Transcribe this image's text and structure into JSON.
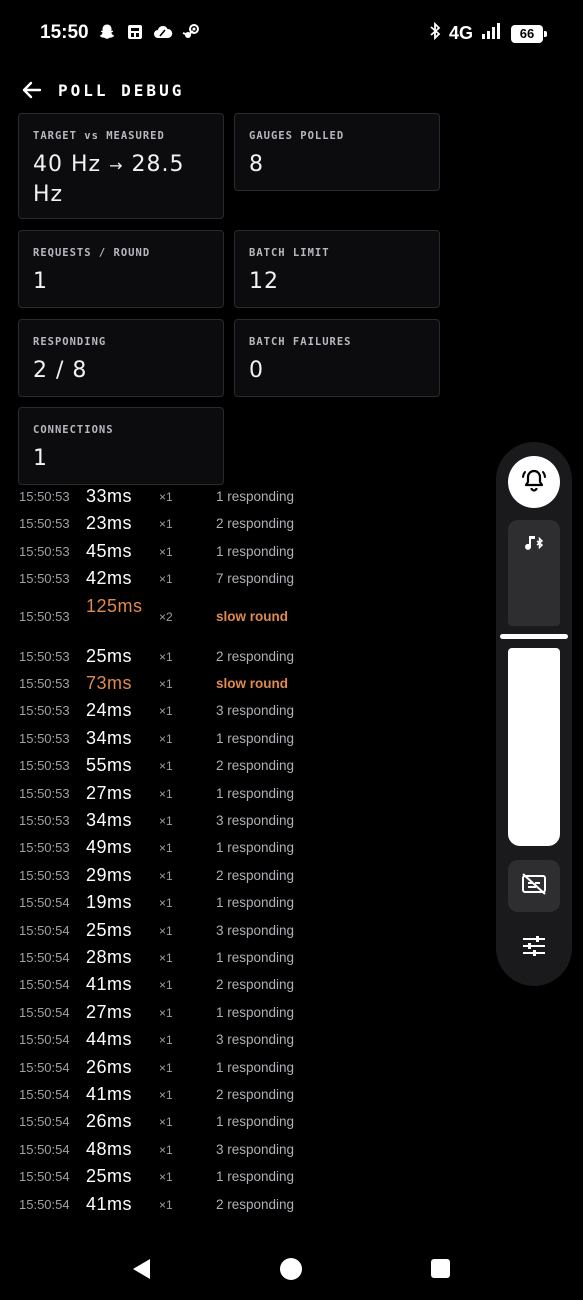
{
  "status": {
    "time": "15:50",
    "network": "4G",
    "battery": "66"
  },
  "header": {
    "title": "POLL DEBUG"
  },
  "cards": {
    "target": {
      "label": "TARGET vs MEASURED",
      "value_a": "40 Hz",
      "arrow": "→",
      "value_b": "28.5 Hz"
    },
    "gauges": {
      "label": "GAUGES POLLED",
      "value": "8"
    },
    "requests": {
      "label": "REQUESTS / ROUND",
      "value": "1"
    },
    "batch_limit": {
      "label": "BATCH LIMIT",
      "value": "12"
    },
    "responding": {
      "label": "RESPONDING",
      "value": "2 / 8"
    },
    "batch_failures": {
      "label": "BATCH FAILURES",
      "value": "0"
    },
    "connections": {
      "label": "CONNECTIONS",
      "value": "1"
    }
  },
  "log": [
    {
      "time": "15:50:53",
      "ms": "33ms",
      "mult": "×1",
      "status": "1 responding",
      "slow": false
    },
    {
      "time": "15:50:53",
      "ms": "23ms",
      "mult": "×1",
      "status": "2 responding",
      "slow": false
    },
    {
      "time": "15:50:53",
      "ms": "45ms",
      "mult": "×1",
      "status": "1 responding",
      "slow": false
    },
    {
      "time": "15:50:53",
      "ms": "42ms",
      "mult": "×1",
      "status": "7 responding",
      "slow": false
    },
    {
      "time": "15:50:53",
      "ms": "125ms",
      "mult": "×2",
      "status": "slow round",
      "slow": true
    },
    {
      "time": "15:50:53",
      "ms": "25ms",
      "mult": "×1",
      "status": "2 responding",
      "slow": false
    },
    {
      "time": "15:50:53",
      "ms": "73ms",
      "mult": "×1",
      "status": "slow round",
      "slow": true
    },
    {
      "time": "15:50:53",
      "ms": "24ms",
      "mult": "×1",
      "status": "3 responding",
      "slow": false
    },
    {
      "time": "15:50:53",
      "ms": "34ms",
      "mult": "×1",
      "status": "1 responding",
      "slow": false
    },
    {
      "time": "15:50:53",
      "ms": "55ms",
      "mult": "×1",
      "status": "2 responding",
      "slow": false
    },
    {
      "time": "15:50:53",
      "ms": "27ms",
      "mult": "×1",
      "status": "1 responding",
      "slow": false
    },
    {
      "time": "15:50:53",
      "ms": "34ms",
      "mult": "×1",
      "status": "3 responding",
      "slow": false
    },
    {
      "time": "15:50:53",
      "ms": "49ms",
      "mult": "×1",
      "status": "1 responding",
      "slow": false
    },
    {
      "time": "15:50:53",
      "ms": "29ms",
      "mult": "×1",
      "status": "2 responding",
      "slow": false
    },
    {
      "time": "15:50:54",
      "ms": "19ms",
      "mult": "×1",
      "status": "1 responding",
      "slow": false
    },
    {
      "time": "15:50:54",
      "ms": "25ms",
      "mult": "×1",
      "status": "3 responding",
      "slow": false
    },
    {
      "time": "15:50:54",
      "ms": "28ms",
      "mult": "×1",
      "status": "1 responding",
      "slow": false
    },
    {
      "time": "15:50:54",
      "ms": "41ms",
      "mult": "×1",
      "status": "2 responding",
      "slow": false
    },
    {
      "time": "15:50:54",
      "ms": "27ms",
      "mult": "×1",
      "status": "1 responding",
      "slow": false
    },
    {
      "time": "15:50:54",
      "ms": "44ms",
      "mult": "×1",
      "status": "3 responding",
      "slow": false
    },
    {
      "time": "15:50:54",
      "ms": "26ms",
      "mult": "×1",
      "status": "1 responding",
      "slow": false
    },
    {
      "time": "15:50:54",
      "ms": "41ms",
      "mult": "×1",
      "status": "2 responding",
      "slow": false
    },
    {
      "time": "15:50:54",
      "ms": "26ms",
      "mult": "×1",
      "status": "1 responding",
      "slow": false
    },
    {
      "time": "15:50:54",
      "ms": "48ms",
      "mult": "×1",
      "status": "3 responding",
      "slow": false
    },
    {
      "time": "15:50:54",
      "ms": "25ms",
      "mult": "×1",
      "status": "1 responding",
      "slow": false
    },
    {
      "time": "15:50:54",
      "ms": "41ms",
      "mult": "×1",
      "status": "2 responding",
      "slow": false
    }
  ],
  "icons": {
    "status_left": [
      "snapchat-icon",
      "card-icon",
      "cloud-icon",
      "steam-icon"
    ],
    "status_right": [
      "bluetooth-icon",
      "signal-icon",
      "battery-icon"
    ],
    "panel": [
      "bell-icon",
      "bluetooth-music-icon",
      "captions-off-icon",
      "equalizer-icon"
    ]
  },
  "colors": {
    "slow": "#e08a4b",
    "card_bg": "#0c0c0e",
    "card_border": "#2a2a2e"
  },
  "volume_panel": {
    "music_level": 0,
    "volume_level": 1.0
  }
}
